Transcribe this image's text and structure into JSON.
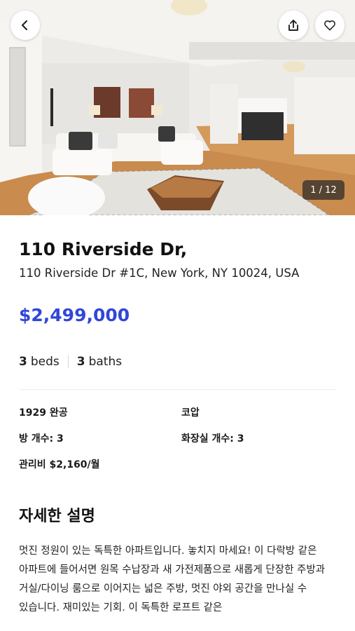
{
  "gallery": {
    "counter": "1 / 12",
    "icons": {
      "back": "chevron-left-icon",
      "share": "share-icon",
      "favorite": "heart-icon"
    }
  },
  "listing": {
    "title": "110 Riverside Dr,",
    "address": "110 Riverside Dr #1C, New York, NY 10024, USA",
    "price": "$2,499,000",
    "beds_count": "3",
    "beds_label": "beds",
    "baths_count": "3",
    "baths_label": "baths"
  },
  "facts": {
    "built": "1929 완공",
    "type": "코압",
    "rooms": "방 개수: 3",
    "bathrooms": "화장실 개수: 3",
    "maintenance": "관리비 $2,160/월"
  },
  "description": {
    "heading": "자세한 설명",
    "text": "멋진 정원이 있는 독특한 아파트입니다. 놓치지 마세요! 이 다락방 같은 아파트에 들어서면 원목 수납장과 새 가전제품으로 새롭게 단장한 주방과 거실/다이닝 룸으로 이어지는 넓은 주방, 멋진 야외 공간을 만나실 수 있습니다. 재미있는 기회. 이 독특한 로프트 같은"
  },
  "colors": {
    "price": "#3047d9",
    "counter_bg": "#282828"
  }
}
